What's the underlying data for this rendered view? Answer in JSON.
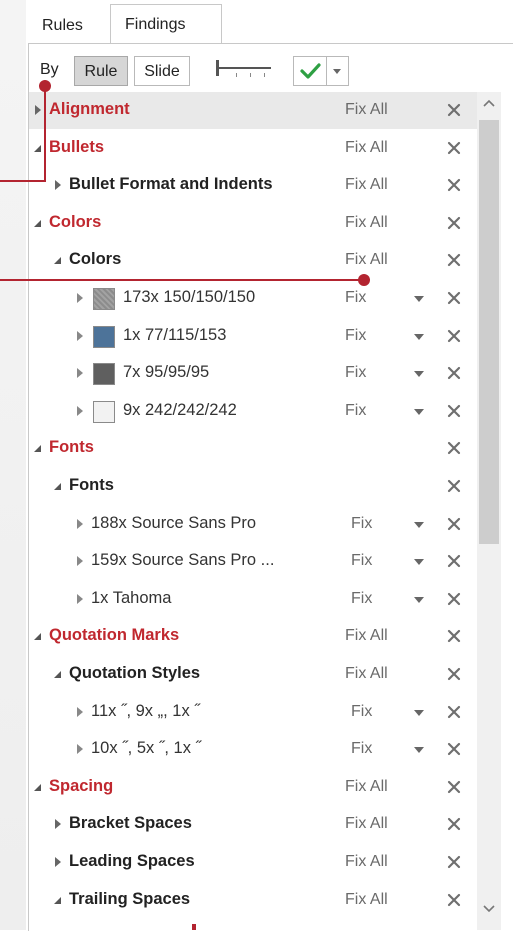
{
  "tabs": [
    {
      "label": "Rules",
      "active": false
    },
    {
      "label": "Findings",
      "active": true
    }
  ],
  "toolbar": {
    "by_label": "By",
    "rule_label": "Rule",
    "slide_label": "Slide",
    "slider_icon": "slider-icon",
    "check_icon": "check-icon",
    "dropdown_icon": "chevron-down-icon",
    "accent_check": "#2ea043"
  },
  "colors": {
    "category": "#c0282f",
    "callout": "#b32430"
  },
  "rows": [
    {
      "level": 0,
      "label": "Alignment",
      "action": "Fix All",
      "expanded": false,
      "selected": true
    },
    {
      "level": 0,
      "label": "Bullets",
      "action": "Fix All",
      "expanded": true
    },
    {
      "level": 1,
      "label": "Bullet Format and Indents",
      "action": "Fix All",
      "expanded": false
    },
    {
      "level": 0,
      "label": "Colors",
      "action": "Fix All",
      "expanded": true
    },
    {
      "level": 1,
      "label": "Colors",
      "action": "Fix All",
      "expanded": true
    },
    {
      "level": 2,
      "label": "173x 150/150/150",
      "action": "Fix",
      "swatch": "#969696",
      "swatch_pattern": true
    },
    {
      "level": 2,
      "label": "1x 77/115/153",
      "action": "Fix",
      "swatch": "#4d7399"
    },
    {
      "level": 2,
      "label": "7x 95/95/95",
      "action": "Fix",
      "swatch": "#5f5f5f"
    },
    {
      "level": 2,
      "label": "9x 242/242/242",
      "action": "Fix",
      "swatch": "#f2f2f2"
    },
    {
      "level": 0,
      "label": "Fonts",
      "action": "",
      "expanded": true
    },
    {
      "level": 1,
      "label": "Fonts",
      "action": "",
      "expanded": true
    },
    {
      "level": 2,
      "label": "188x Source Sans Pro",
      "action": "Fix",
      "plain": true
    },
    {
      "level": 2,
      "label": "159x Source Sans Pro ...",
      "action": "Fix",
      "plain": true
    },
    {
      "level": 2,
      "label": "1x Tahoma",
      "action": "Fix",
      "plain": true
    },
    {
      "level": 0,
      "label": "Quotation Marks",
      "action": "Fix All",
      "expanded": true
    },
    {
      "level": 1,
      "label": "Quotation Styles",
      "action": "Fix All",
      "expanded": true
    },
    {
      "level": 2,
      "label": "11x ˝, 9x „, 1x ˝",
      "action": "Fix",
      "plain": true
    },
    {
      "level": 2,
      "label": "10x ˝, 5x ˝, 1x ˝",
      "action": "Fix",
      "plain": true
    },
    {
      "level": 0,
      "label": "Spacing",
      "action": "Fix All",
      "expanded": true
    },
    {
      "level": 1,
      "label": "Bracket Spaces",
      "action": "Fix All",
      "expanded": false
    },
    {
      "level": 1,
      "label": "Leading Spaces",
      "action": "Fix All",
      "expanded": false
    },
    {
      "level": 1,
      "label": "Trailing Spaces",
      "action": "Fix All",
      "expanded": true
    }
  ]
}
